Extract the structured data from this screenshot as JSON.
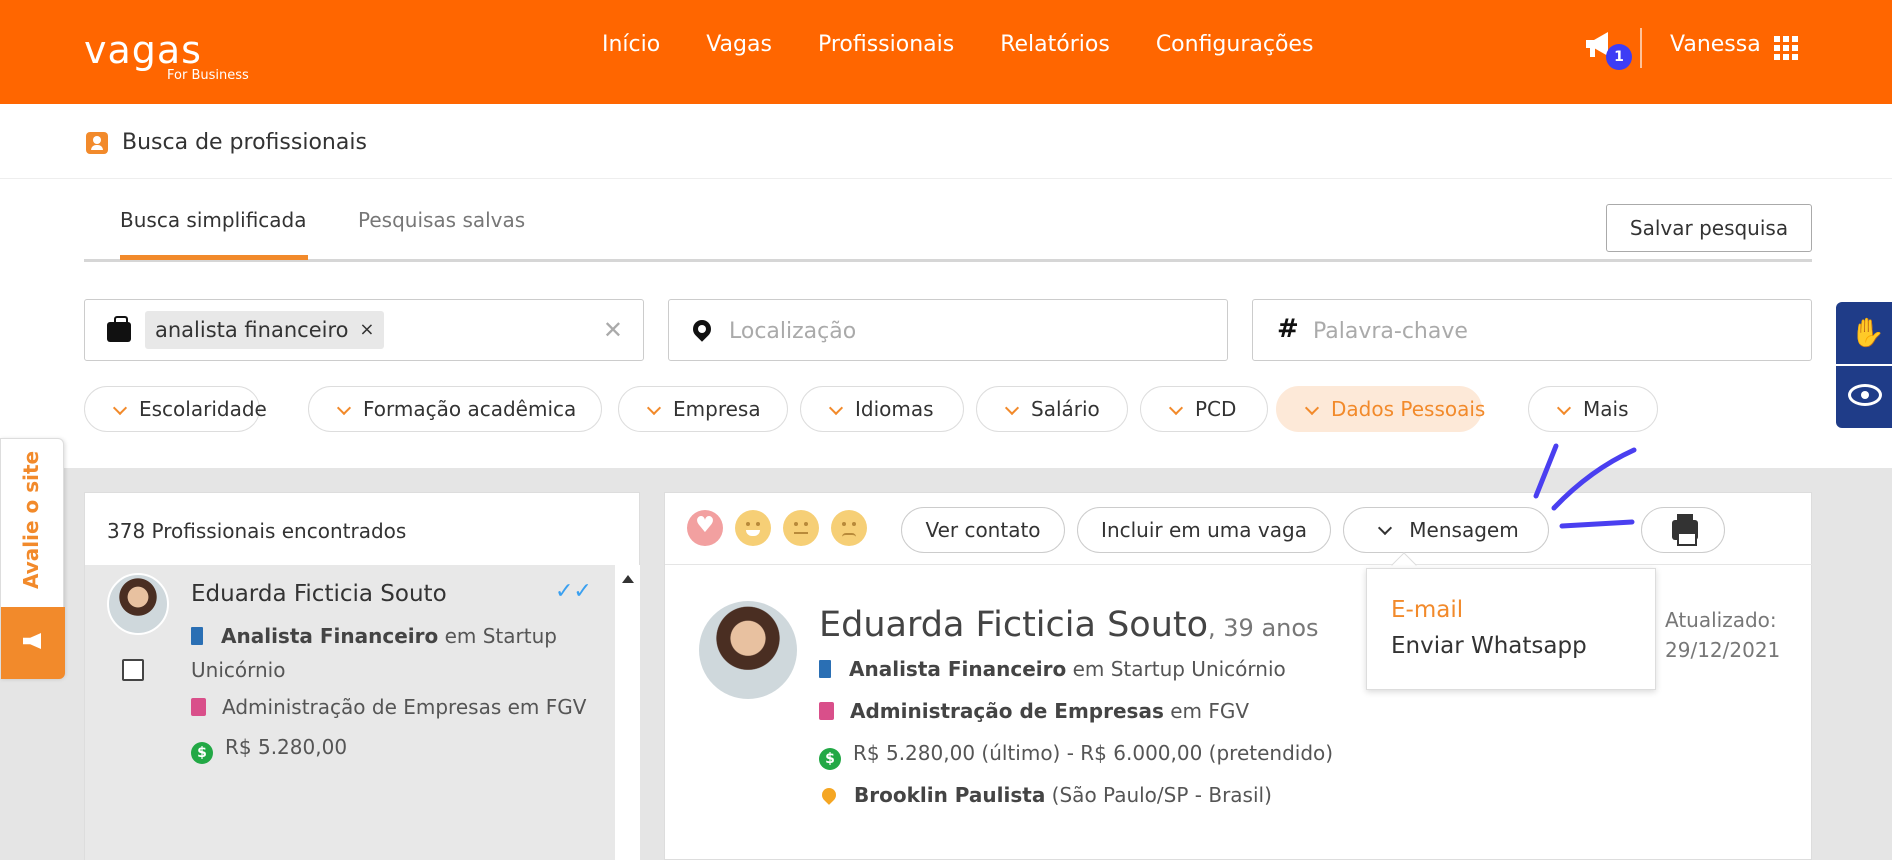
{
  "header": {
    "logo_main": "vagas",
    "logo_sub": "For Business",
    "nav": [
      "Início",
      "Vagas",
      "Profissionais",
      "Relatórios",
      "Configurações"
    ],
    "notification_count": "1",
    "user_name": "Vanessa",
    "brand_color": "#ff6600"
  },
  "page": {
    "title": "Busca de profissionais",
    "tabs": [
      {
        "label": "Busca simplificada",
        "active": true
      },
      {
        "label": "Pesquisas salvas",
        "active": false
      }
    ],
    "save_search_label": "Salvar pesquisa"
  },
  "search": {
    "position_chip": "analista financeiro",
    "location_placeholder": "Localização",
    "keyword_placeholder": "Palavra-chave"
  },
  "filters": [
    {
      "label": "Escolaridade",
      "active": false
    },
    {
      "label": "Formação acadêmica",
      "active": false
    },
    {
      "label": "Empresa",
      "active": false
    },
    {
      "label": "Idiomas",
      "active": false
    },
    {
      "label": "Salário",
      "active": false
    },
    {
      "label": "PCD",
      "active": false
    },
    {
      "label": "Dados Pessoais",
      "active": true
    },
    {
      "label": "Mais",
      "active": false
    }
  ],
  "results": {
    "count_label": "378 Profissionais encontrados",
    "items": [
      {
        "name": "Eduarda Ficticia Souto",
        "role": "Analista Financeiro",
        "role_connector": "em Startup Unicórnio",
        "education": "Administração de Empresas em FGV",
        "salary": "R$ 5.280,00"
      }
    ]
  },
  "detail": {
    "actions": {
      "contact": "Ver contato",
      "include": "Incluir em uma vaga",
      "message": "Mensagem"
    },
    "name": "Eduarda Ficticia Souto",
    "age": ", 39 anos",
    "role": "Analista Financeiro",
    "role_connector": " em Startup Unicórnio",
    "education": "Administração de Empresas",
    "education_connector": " em FGV",
    "salary": "R$ 5.280,00 (último) - R$ 6.000,00 (pretendido)",
    "location": "Brooklin Paulista",
    "location_detail": " (São Paulo/SP - Brasil)",
    "updated_label": "Atualizado:",
    "updated_date": "29/12/2021"
  },
  "message_menu": {
    "items": [
      "E-mail",
      "Enviar Whatsapp"
    ]
  },
  "feedback": {
    "label": "Avalie o site"
  }
}
